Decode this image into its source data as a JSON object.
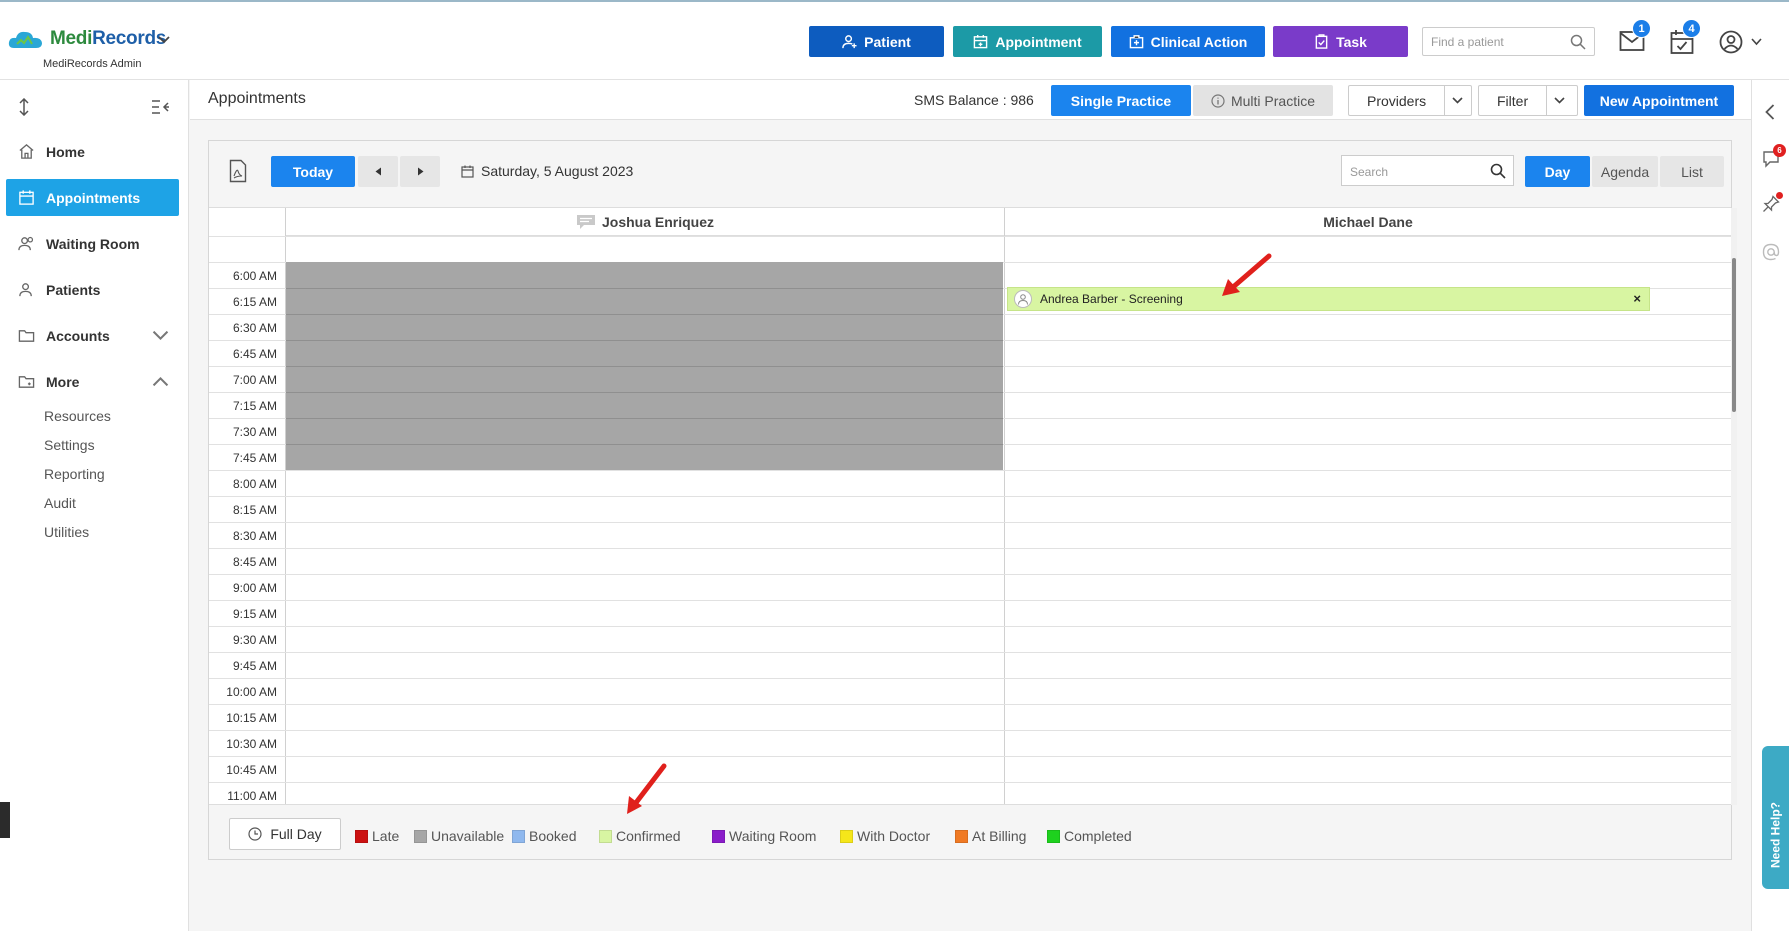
{
  "header": {
    "logo": {
      "part1": "Medi",
      "part2": "Records",
      "subtitle": "MediRecords Admin"
    },
    "buttons": [
      {
        "label": "Patient",
        "color": "#0d5cbf"
      },
      {
        "label": "Appointment",
        "color": "#1c9aa6"
      },
      {
        "label": "Clinical Action",
        "color": "#1271e0"
      },
      {
        "label": "Task",
        "color": "#7a3bc9"
      }
    ],
    "find_placeholder": "Find a patient",
    "mail_badge": "1",
    "calendar_badge": "4"
  },
  "sidebar": {
    "items": [
      {
        "label": "Home"
      },
      {
        "label": "Appointments"
      },
      {
        "label": "Waiting Room"
      },
      {
        "label": "Patients"
      },
      {
        "label": "Accounts"
      },
      {
        "label": "More"
      }
    ],
    "sub_items": [
      "Resources",
      "Settings",
      "Reporting",
      "Audit",
      "Utilities"
    ]
  },
  "page": {
    "title": "Appointments",
    "sms_balance": "SMS Balance : 986",
    "single_practice": "Single Practice",
    "multi_practice": "Multi Practice",
    "providers": "Providers",
    "filter": "Filter",
    "new_appointment": "New Appointment"
  },
  "toolbar": {
    "today": "Today",
    "date": "Saturday, 5 August 2023",
    "search_placeholder": "Search",
    "views": [
      "Day",
      "Agenda",
      "List"
    ]
  },
  "schedule": {
    "providers": [
      "Joshua Enriquez",
      "Michael Dane"
    ],
    "times": [
      "6:00 AM",
      "6:15 AM",
      "6:30 AM",
      "6:45 AM",
      "7:00 AM",
      "7:15 AM",
      "7:30 AM",
      "7:45 AM",
      "8:00 AM",
      "8:15 AM",
      "8:30 AM",
      "8:45 AM",
      "9:00 AM",
      "9:15 AM",
      "9:30 AM",
      "9:45 AM",
      "10:00 AM",
      "10:15 AM",
      "10:30 AM",
      "10:45 AM",
      "11:00 AM"
    ],
    "appointment": {
      "label": "Andrea Barber - Screening",
      "close": "×"
    }
  },
  "legend": {
    "full_day": "Full Day",
    "items": [
      {
        "label": "Late",
        "color": "#cc1111"
      },
      {
        "label": "Unavailable",
        "color": "#a6a6a6"
      },
      {
        "label": "Booked",
        "color": "#8fb8ee"
      },
      {
        "label": "Confirmed",
        "color": "#d8f5a2"
      },
      {
        "label": "Waiting Room",
        "color": "#8a1cc9"
      },
      {
        "label": "With Doctor",
        "color": "#f5e61a"
      },
      {
        "label": "At Billing",
        "color": "#f07a24"
      },
      {
        "label": "Completed",
        "color": "#1ed11e"
      }
    ]
  },
  "right_panel": {
    "notifications_badge": "6",
    "help_label": "Need Help?"
  },
  "colors": {
    "accent": "#1ea3e6",
    "primary": "#1271e0",
    "blocked": "#a6a6a6",
    "confirmed": "#d8f5a2"
  }
}
